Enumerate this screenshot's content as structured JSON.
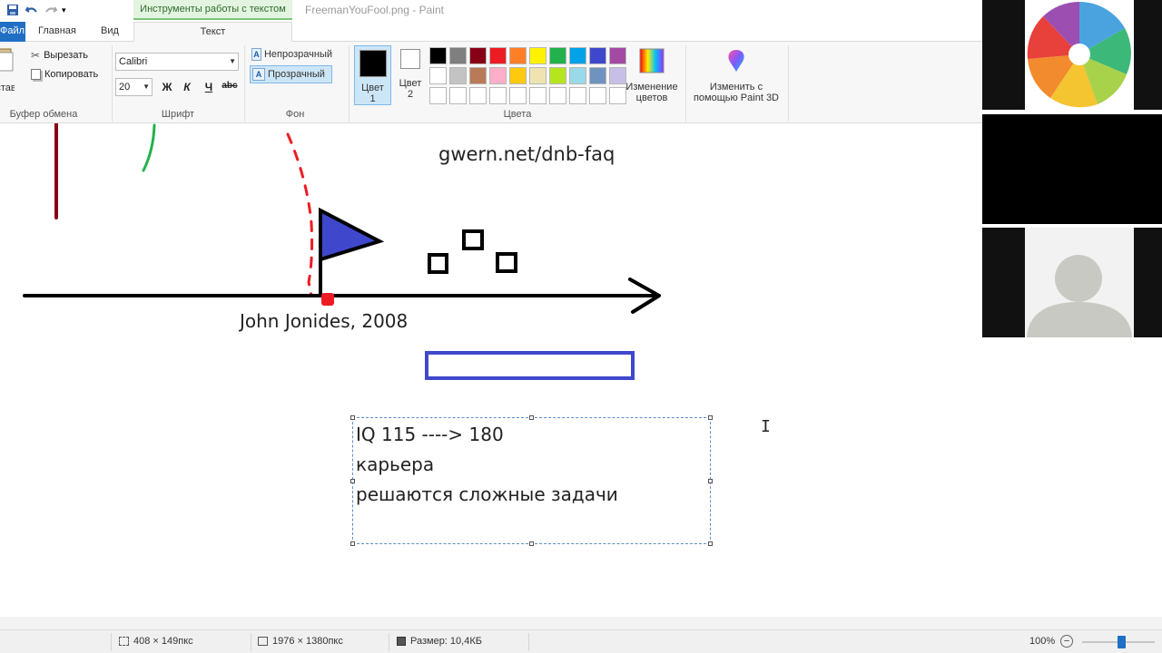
{
  "titlebar": {
    "context_tab": "Инструменты работы с текстом",
    "document_title": "FreemanYouFool.png - Paint"
  },
  "ribbon_tabs": {
    "file": "Файл",
    "home": "Главная",
    "view": "Вид",
    "text": "Текст"
  },
  "clipboard": {
    "paste": "Вставить",
    "cut": "Вырезать",
    "copy": "Копировать",
    "group": "Буфер обмена"
  },
  "font": {
    "family": "Calibri",
    "size": "20",
    "bold": "Ж",
    "italic": "К",
    "underline": "Ч",
    "strike": "abc",
    "group": "Шрифт"
  },
  "background": {
    "opaque": "Непрозрачный",
    "transparent": "Прозрачный",
    "group": "Фон",
    "selected": "transparent"
  },
  "colors": {
    "color1_label_line1": "Цвет",
    "color1_label_line2": "1",
    "color2_label_line1": "Цвет",
    "color2_label_line2": "2",
    "color1": "#000000",
    "color2": "#ffffff",
    "group": "Цвета",
    "edit_line1": "Изменение",
    "edit_line2": "цветов",
    "paint3d_line1": "Изменить с",
    "paint3d_line2": "помощью Paint 3D",
    "palette": [
      "#000000",
      "#7f7f7f",
      "#880015",
      "#ed1c24",
      "#ff7f27",
      "#fff200",
      "#22b14c",
      "#00a2e8",
      "#3f48cc",
      "#a349a4",
      "#ffffff",
      "#c3c3c3",
      "#b97a57",
      "#ffaec9",
      "#ffc90e",
      "#efe4b0",
      "#b5e61d",
      "#99d9ea",
      "#7092be",
      "#c8bfe7",
      "#ffffff",
      "#ffffff",
      "#ffffff",
      "#ffffff",
      "#ffffff",
      "#ffffff",
      "#ffffff",
      "#ffffff",
      "#ffffff",
      "#ffffff"
    ]
  },
  "canvas": {
    "url_text": "gwern.net/dnb-faq",
    "author_text": "John Jonides, 2008",
    "textbox_lines": [
      "IQ 115 ----> 180",
      "карьера",
      "решаются сложные задачи"
    ],
    "drawing_colors": {
      "axis": "#000000",
      "flag": "#3f48cc",
      "dark_red": "#880015",
      "green": "#22b14c",
      "red": "#ed1c24",
      "blue_rect": "#3f48cc"
    }
  },
  "status": {
    "selection_size": "408 × 149пкс",
    "image_size": "1976 × 1380пкс",
    "file_size": "Размер: 10,4КБ",
    "zoom": "100%"
  },
  "video_panel": {
    "tiles": [
      "logo",
      "blank",
      "avatar"
    ]
  }
}
